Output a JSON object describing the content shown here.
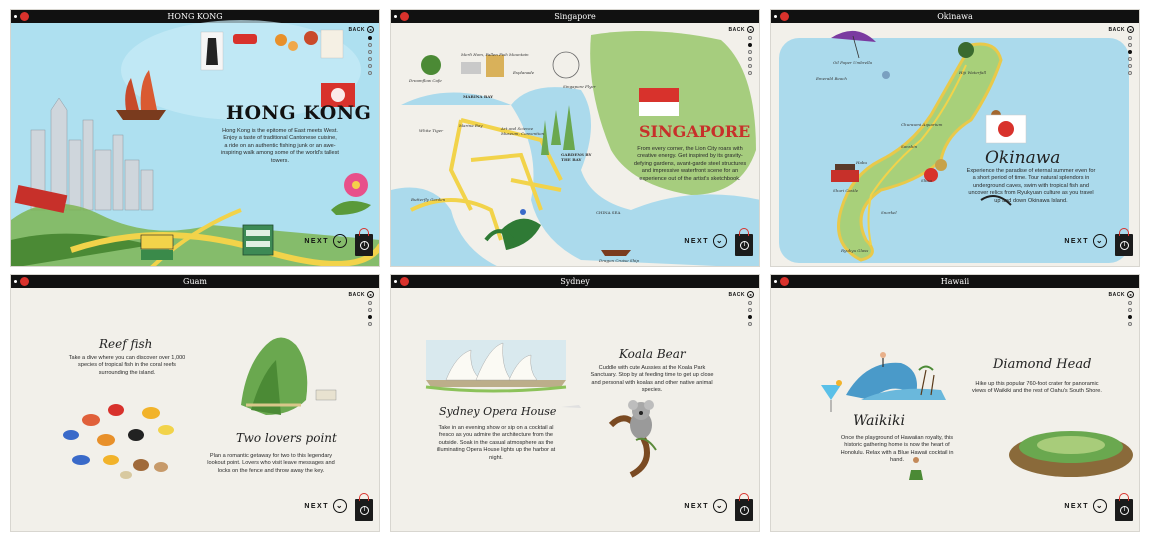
{
  "common": {
    "back_label": "BACK",
    "next_label": "NEXT",
    "next_arrow": "⌄",
    "back_arrow": "◂"
  },
  "panels": [
    {
      "bar_title": "HONG KONG",
      "title": "HONG KONG",
      "description": "Hong Kong is the epitome of East meets West. Enjoy a taste of traditional Cantonese cuisine, a ride on an authentic fishing junk or an awe-inspiring walk among some of the world's tallest towers."
    },
    {
      "bar_title": "Singapore",
      "title": "SINGAPORE",
      "description": "From every corner, the Lion City roars with creative energy. Get inspired by its gravity-defying gardens, avant-garde steel structures and impressive waterfront scene for an experience out of the artist's sketchbook.",
      "labels": [
        "Dreamflow Cafe",
        "Merli Hom, Fallen Fish Mountain",
        "Esplanade",
        "Singapore Flyer",
        "MARINA BAY",
        "Marina Bay",
        "White Tiger",
        "Art and Science Museum, Convention",
        "GARDENS BY THE BAY",
        "Butterfly Garden",
        "CHINA SEA",
        "Dragon Cruise Ship"
      ]
    },
    {
      "bar_title": "Okinawa",
      "title": "Okinawa",
      "description": "Experience the paradise of eternal summer even for a short period of time. Tour natural splendors in underground caves, swim with tropical fish and uncover relics from Ryukyuan culture as you travel up and down Okinawa Island.",
      "labels": [
        "Oil Paper Umbrella",
        "Hiji Waterfall",
        "Emerald Beach",
        "Churaumi Aquarium",
        "Shuri Castle",
        "Sanshin",
        "Shisa",
        "Ryukyu Glass",
        "Habu",
        "Snorkel"
      ]
    },
    {
      "bar_title": "Guam",
      "reef_title": "Reef fish",
      "reef_desc": "Take a dive where you can discover over 1,000 species of tropical fish in the coral reefs surrounding the island.",
      "lovers_title": "Two lovers point",
      "lovers_desc": "Plan a romantic getaway for two to this legendary lookout point. Lovers who visit leave messages and locks on the fence and throw away the key."
    },
    {
      "bar_title": "Sydney",
      "koala_title": "Koala Bear",
      "koala_desc": "Cuddle with cute Aussies at the Koala Park Sanctuary. Stop by at feeding time to get up close and personal with koalas and other native animal species.",
      "opera_title": "Sydney Opera House",
      "opera_desc": "Take in an evening show or sip on a cocktail al fresco as you admire the architecture from the outside. Soak in the casual atmosphere as the illuminating Opera House lights up the harbor at night."
    },
    {
      "bar_title": "Hawaii",
      "diamond_title": "Diamond Head",
      "diamond_desc": "Hike up this popular 760-foot crater for panoramic views of Waikiki and the rest of Oahu's South Shore.",
      "waikiki_title": "Waikiki",
      "waikiki_desc": "Once the playground of Hawaiian royalty, this historic gathering home is now the heart of Honolulu. Relax with a Blue Hawaii cocktail in hand."
    }
  ],
  "colors": {
    "bar": "#111111",
    "accent_red": "#d8322c",
    "sea_blue": "#9fd6ec",
    "paper": "#f2f0ea"
  }
}
